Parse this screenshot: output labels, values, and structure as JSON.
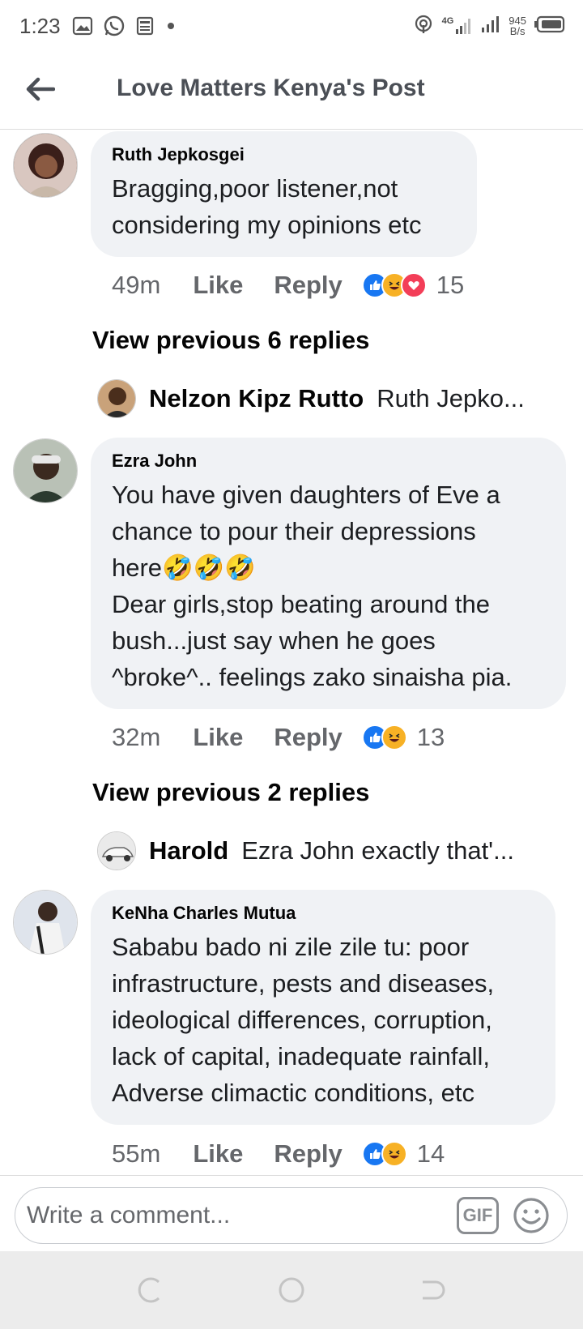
{
  "status_bar": {
    "time": "1:23",
    "network_type": "4G",
    "net_speed_value": "945",
    "net_speed_unit": "B/s"
  },
  "header": {
    "title": "Love Matters Kenya's Post"
  },
  "comments": [
    {
      "author": "Ruth Jepkosgei",
      "text": "Bragging,poor listener,not\nconsidering my opinions etc",
      "time": "49m",
      "like_label": "Like",
      "reply_label": "Reply",
      "reactions": [
        "like-icon",
        "haha-icon",
        "love-icon"
      ],
      "reaction_count": "15",
      "view_previous": "View previous 6 replies",
      "reply_preview": {
        "name": "Nelzon Kipz Rutto",
        "text": "Ruth Jepko..."
      }
    },
    {
      "author": "Ezra John",
      "text_line1": "You have given daughters of Eve a\nchance to pour their depressions\nhere",
      "text_emojis": "🤣🤣🤣",
      "text_line2": "Dear girls,stop beating around the\nbush...just say when he goes\n^broke^.. feelings zako sinaisha pia.",
      "time": "32m",
      "like_label": "Like",
      "reply_label": "Reply",
      "reactions": [
        "like-icon",
        "haha-icon"
      ],
      "reaction_count": "13",
      "view_previous": "View previous 2 replies",
      "reply_preview": {
        "name": "Harold",
        "text": "Ezra John exactly that'..."
      }
    },
    {
      "author": "KeNha Charles Mutua",
      "text": "Sababu bado ni zile zile tu: poor\ninfrastructure, pests and diseases,\nideological differences, corruption,\nlack of capital, inadequate rainfall,\nAdverse climactic conditions, etc",
      "time": "55m",
      "like_label": "Like",
      "reply_label": "Reply",
      "reactions": [
        "like-icon",
        "haha-icon"
      ],
      "reaction_count": "14"
    }
  ],
  "composer": {
    "placeholder": "Write a comment...",
    "gif_label": "GIF"
  },
  "colors": {
    "bubble": "#f0f2f5",
    "like": "#1877f2",
    "haha": "#f7b125",
    "love": "#f33e58",
    "meta_text": "#65676b"
  }
}
